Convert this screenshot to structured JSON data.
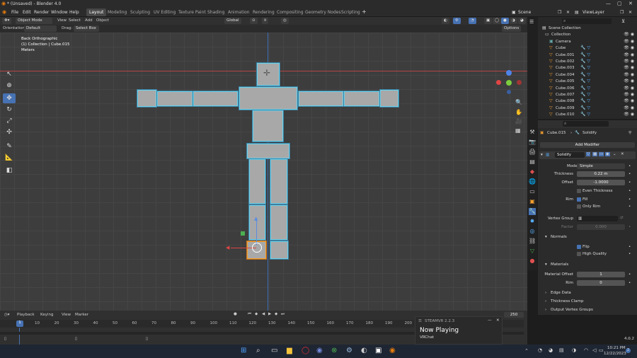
{
  "window": {
    "title": "* (Unsaved) - Blender 4.0"
  },
  "menu": [
    "File",
    "Edit",
    "Render",
    "Window",
    "Help"
  ],
  "workspaces": [
    "Layout",
    "Modeling",
    "Sculpting",
    "UV Editing",
    "Texture Paint",
    "Shading",
    "Animation",
    "Rendering",
    "Compositing",
    "Geometry Nodes",
    "Scripting"
  ],
  "active_workspace": "Layout",
  "scene": {
    "label": "Scene",
    "view_layer": "ViewLayer"
  },
  "viewport_header": {
    "mode": "Object Mode",
    "view": "View",
    "select": "Select",
    "add": "Add",
    "object": "Object",
    "transform": "Global"
  },
  "viewport_header2": {
    "orientation_label": "Orientation:",
    "orientation_value": "Default",
    "drag_label": "Drag:",
    "drag_value": "Select Box",
    "options": "Options"
  },
  "viewport_info": {
    "view": "Back Orthographic",
    "collection": "(1) Collection | Cube.015",
    "units": "Meters"
  },
  "outliner": {
    "search_placeholder": "",
    "rows": [
      {
        "name": "Scene Collection",
        "type": "scene"
      },
      {
        "name": "Collection",
        "type": "collection"
      },
      {
        "name": "Camera",
        "type": "camera"
      },
      {
        "name": "Cube",
        "type": "mesh"
      },
      {
        "name": "Cube.001",
        "type": "mesh"
      },
      {
        "name": "Cube.002",
        "type": "mesh"
      },
      {
        "name": "Cube.003",
        "type": "mesh"
      },
      {
        "name": "Cube.004",
        "type": "mesh"
      },
      {
        "name": "Cube.005",
        "type": "mesh"
      },
      {
        "name": "Cube.006",
        "type": "mesh"
      },
      {
        "name": "Cube.007",
        "type": "mesh"
      },
      {
        "name": "Cube.008",
        "type": "mesh"
      },
      {
        "name": "Cube.009",
        "type": "mesh"
      },
      {
        "name": "Cube.010",
        "type": "mesh"
      }
    ]
  },
  "properties": {
    "object": "Cube.015",
    "modifier_tab": "Solidify",
    "add_modifier": "Add Modifier",
    "modifier_name": "Solidify",
    "mode_label": "Mode",
    "mode_value": "Simple",
    "thickness_label": "Thickness",
    "thickness_value": "0.22 m",
    "offset_label": "Offset",
    "offset_value": "-1.0000",
    "even_thickness": "Even Thickness",
    "rim_label": "Rim",
    "fill": "Fill",
    "only_rim": "Only Rim",
    "vertex_group_label": "Vertex Group",
    "factor_label": "Factor",
    "factor_value": "0.000",
    "normals": "Normals",
    "flip": "Flip",
    "high_quality": "High Quality",
    "materials": "Materials",
    "material_offset_label": "Material Offset",
    "material_offset_value": "1",
    "rim_mat_label": "Rim",
    "rim_mat_value": "0",
    "edge_data": "Edge Data",
    "thickness_clamp": "Thickness Clamp",
    "output_vertex_groups": "Output Vertex Groups"
  },
  "timeline": {
    "playback": "Playback",
    "keying": "Keying",
    "view": "View",
    "marker": "Marker",
    "current_frame": "1",
    "end_frame": "250",
    "ticks": [
      "10",
      "20",
      "30",
      "40",
      "50",
      "60",
      "70",
      "80",
      "90",
      "100",
      "110",
      "120",
      "130",
      "140",
      "150",
      "160",
      "170",
      "180",
      "190",
      "200"
    ]
  },
  "notification": {
    "app": "STEAMVR 2.2.3",
    "title": "Now Playing",
    "body": "VRChat"
  },
  "status": {
    "version": "4.0.2"
  },
  "taskbar": {
    "time": "10:21 PM",
    "date": "12/22/2023",
    "badge": "2"
  }
}
